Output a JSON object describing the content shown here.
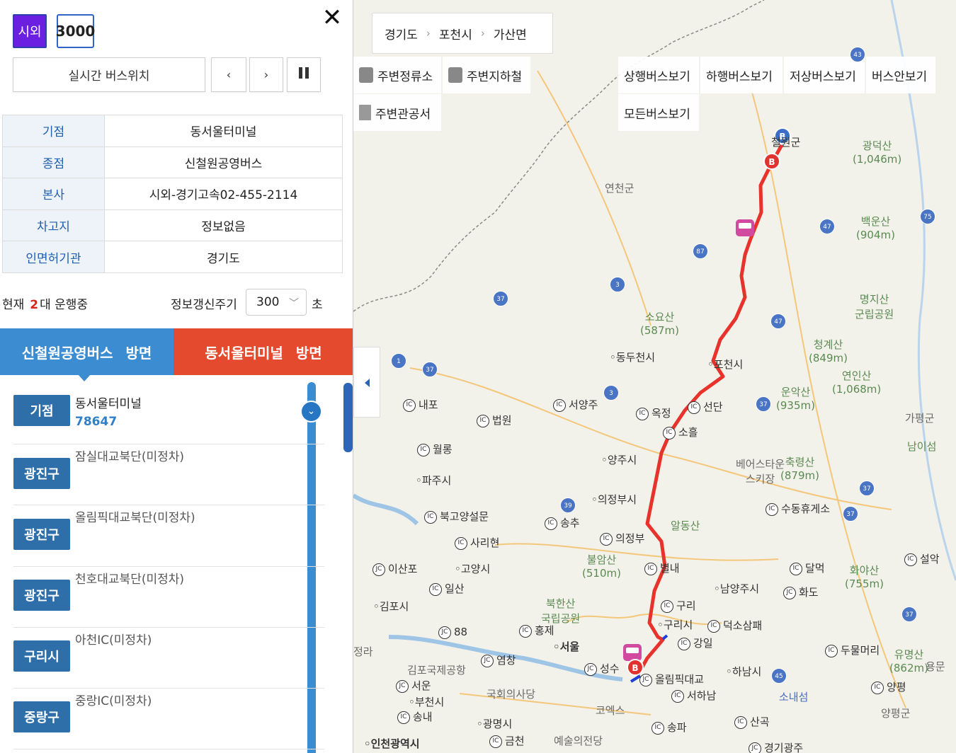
{
  "header": {
    "route_type": "시외",
    "route_number": "3000",
    "close_icon": "✕"
  },
  "controls": {
    "realtime_label": "실시간 버스위치",
    "prev_label": "‹",
    "next_label": "›",
    "pause_icon": "pause-icon"
  },
  "info_table": [
    {
      "key": "기점",
      "value": "동서울터미널"
    },
    {
      "key": "종점",
      "value": "신철원공영버스"
    },
    {
      "key": "본사",
      "value": "시외-경기고속02-455-2114"
    },
    {
      "key": "차고지",
      "value": "정보없음"
    },
    {
      "key": "인면허기관",
      "value": "경기도"
    }
  ],
  "status": {
    "prefix": "현재",
    "count": "2",
    "suffix": "대 운행중",
    "refresh_label": "정보갱신주기",
    "refresh_value": "300",
    "refresh_unit": "초"
  },
  "direction_tabs": [
    {
      "name": "신철원공영버스",
      "suffix": "방면",
      "color": "#3b8cd0"
    },
    {
      "name": "동서울터미널",
      "suffix": "방면",
      "color": "#e44a2e"
    }
  ],
  "stops": [
    {
      "badge": "기점",
      "name": "동서울터미널",
      "id": "78647"
    },
    {
      "badge": "광진구",
      "name": "잠실대교북단(미정차)"
    },
    {
      "badge": "광진구",
      "name": "올림픽대교북단(미정차)"
    },
    {
      "badge": "광진구",
      "name": "천호대교북단(미정차)"
    },
    {
      "badge": "구리시",
      "name": "아천IC(미정차)"
    },
    {
      "badge": "중랑구",
      "name": "중랑IC(미정차)"
    }
  ],
  "map": {
    "breadcrumb": [
      "경기도",
      "포천시",
      "가산면"
    ],
    "nearby": [
      "주변정류소",
      "주변지하철",
      "주변관공서"
    ],
    "view_buttons": [
      "상행버스보기",
      "하행버스보기",
      "저상버스보기",
      "버스안보기",
      "모든버스보기"
    ],
    "route_color": "#e8322c",
    "places": [
      {
        "label": "철원군",
        "cls": ""
      },
      {
        "label": "연천군",
        "cls": "grey"
      },
      {
        "label": "광덕산",
        "sub": "(1,046m)",
        "cls": "green"
      },
      {
        "label": "백운산",
        "sub": "(904m)",
        "cls": "green"
      },
      {
        "label": "명지산",
        "sub": "군립공원",
        "cls": "green"
      },
      {
        "label": "소요산",
        "sub": "(587m)",
        "cls": "green"
      },
      {
        "label": "청계산",
        "sub": "(849m)",
        "cls": "green"
      },
      {
        "label": "연인산",
        "sub": "(1,068m)",
        "cls": "green"
      },
      {
        "label": "운악산",
        "sub": "(935m)",
        "cls": "green"
      },
      {
        "label": "동두천시",
        "cls": "dot"
      },
      {
        "label": "포천시",
        "cls": "dot"
      },
      {
        "label": "선단",
        "cls": "ic"
      },
      {
        "label": "내포",
        "cls": "ic"
      },
      {
        "label": "서양주",
        "cls": "ic"
      },
      {
        "label": "옥정",
        "cls": "ic"
      },
      {
        "label": "소흘",
        "cls": "ic"
      },
      {
        "label": "법원",
        "cls": "ic"
      },
      {
        "label": "월롱",
        "cls": "ic"
      },
      {
        "label": "양주시",
        "cls": "dot"
      },
      {
        "label": "베어스타운",
        "sub": "스키장",
        "cls": "grey"
      },
      {
        "label": "축령산",
        "sub": "(879m)",
        "cls": "green"
      },
      {
        "label": "가평군",
        "cls": "grey"
      },
      {
        "label": "남이섬",
        "cls": "green"
      },
      {
        "label": "파주시",
        "cls": "dot"
      },
      {
        "label": "의정부시",
        "cls": "dot"
      },
      {
        "label": "수동휴게소",
        "cls": "ic"
      },
      {
        "label": "북고양설문",
        "cls": "ic"
      },
      {
        "label": "송추",
        "cls": "ic"
      },
      {
        "label": "알동산",
        "cls": "green"
      },
      {
        "label": "사리현",
        "cls": "ic"
      },
      {
        "label": "의정부",
        "cls": "ic"
      },
      {
        "label": "이산포",
        "cls": "jc"
      },
      {
        "label": "고양시",
        "cls": "dot"
      },
      {
        "label": "불암산",
        "sub": "(510m)",
        "cls": "green"
      },
      {
        "label": "별내",
        "cls": "ic"
      },
      {
        "label": "달먹",
        "cls": "ic"
      },
      {
        "label": "화야산",
        "sub": "(755m)",
        "cls": "green"
      },
      {
        "label": "설악",
        "cls": "ic"
      },
      {
        "label": "일산",
        "cls": "ic"
      },
      {
        "label": "남양주시",
        "cls": "dot"
      },
      {
        "label": "화도",
        "cls": "jc"
      },
      {
        "label": "김포시",
        "cls": "dot"
      },
      {
        "label": "북한산",
        "sub": "국립공원",
        "cls": "green"
      },
      {
        "label": "구리",
        "cls": "ic"
      },
      {
        "label": "구리시",
        "cls": "dot"
      },
      {
        "label": "덕소삼패",
        "cls": "ic"
      },
      {
        "label": "88",
        "cls": "jc"
      },
      {
        "label": "홍제",
        "cls": "ic"
      },
      {
        "label": "서울",
        "cls": "dot"
      },
      {
        "label": "강일",
        "cls": "ic"
      },
      {
        "label": "두물머리",
        "cls": "ic"
      },
      {
        "label": "유명산",
        "sub": "(862m)",
        "cls": "green"
      },
      {
        "label": "용문",
        "cls": "grey"
      },
      {
        "label": "김포국제공항",
        "cls": "grey"
      },
      {
        "label": "염창",
        "cls": "jc"
      },
      {
        "label": "성수",
        "cls": "jc"
      },
      {
        "label": "올림픽대교",
        "cls": "jc"
      },
      {
        "label": "하남시",
        "cls": "dot"
      },
      {
        "label": "서운",
        "cls": "jc"
      },
      {
        "label": "국회의사당",
        "cls": "grey"
      },
      {
        "label": "서하남",
        "cls": "ic"
      },
      {
        "label": "소내섬",
        "cls": "blue"
      },
      {
        "label": "양평",
        "cls": "ic"
      },
      {
        "label": "부천시",
        "cls": "dot"
      },
      {
        "label": "코엑스",
        "cls": "grey"
      },
      {
        "label": "양평군",
        "cls": "grey"
      },
      {
        "label": "송내",
        "cls": "ic"
      },
      {
        "label": "광명시",
        "cls": "dot"
      },
      {
        "label": "산곡",
        "cls": "ic"
      },
      {
        "label": "송파",
        "cls": "ic"
      },
      {
        "label": "인천광역시",
        "cls": "dot"
      },
      {
        "label": "금천",
        "cls": "ic"
      },
      {
        "label": "예술의전당",
        "cls": "grey"
      },
      {
        "label": "경기광주",
        "cls": "jc"
      },
      {
        "label": "정라",
        "cls": "grey"
      }
    ]
  }
}
